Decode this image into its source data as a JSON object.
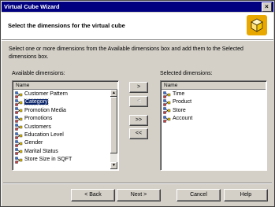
{
  "window": {
    "title": "Virtual Cube Wizard",
    "close_glyph": "×"
  },
  "header": {
    "heading": "Select the dimensions for the virtual cube",
    "icon": "cube-icon"
  },
  "instructions": "Select one or more dimensions from the Available dimensions box and add them to the Selected dimensions box.",
  "available": {
    "label": "Available dimensions:",
    "column_header": "Name",
    "items": [
      {
        "label": "Customer Pattern",
        "icon": "dimension-icon"
      },
      {
        "label": "Category",
        "icon": "dimension-icon",
        "selected": true
      },
      {
        "label": "Promotion Media",
        "icon": "dimension-icon"
      },
      {
        "label": "Promotions",
        "icon": "dimension-icon"
      },
      {
        "label": "Customers",
        "icon": "dimension-icon"
      },
      {
        "label": "Education Level",
        "icon": "dimension-icon"
      },
      {
        "label": "Gender",
        "icon": "dimension-icon"
      },
      {
        "label": "Marital Status",
        "icon": "dimension-icon"
      },
      {
        "label": "Store Size in SQFT",
        "icon": "dimension-icon"
      }
    ]
  },
  "selected": {
    "label": "Selected dimensions:",
    "column_header": "Name",
    "items": [
      {
        "label": "Time",
        "icon": "dimension-icon"
      },
      {
        "label": "Product",
        "icon": "dimension-icon"
      },
      {
        "label": "Store",
        "icon": "dimension-icon"
      },
      {
        "label": "Account",
        "icon": "dimension-icon"
      }
    ]
  },
  "transfer": {
    "add": ">",
    "remove": "<",
    "add_all": ">>",
    "remove_all": "<<"
  },
  "footer": {
    "back": "< Back",
    "next": "Next >",
    "cancel": "Cancel",
    "help": "Help"
  }
}
